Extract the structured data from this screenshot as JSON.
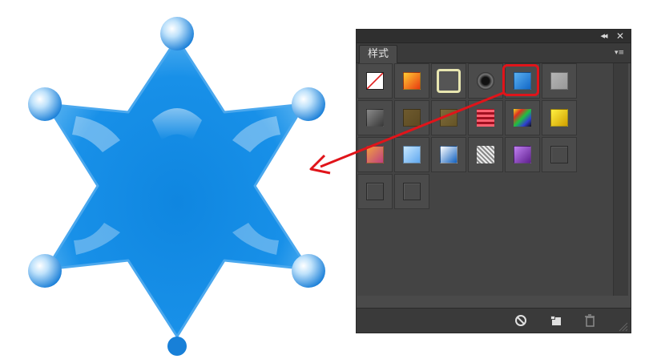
{
  "panel": {
    "tab_label": "样式",
    "collapse_glyph": "◂◂",
    "close_glyph": "✕",
    "menu_glyph": "▾≡"
  },
  "styles": [
    {
      "row": 0,
      "col": 0,
      "name": "style-none",
      "colors": [
        "#ffffff",
        "#e02020"
      ]
    },
    {
      "row": 0,
      "col": 1,
      "name": "style-red-glow",
      "colors": [
        "#ffcc33",
        "#e83a10"
      ]
    },
    {
      "row": 0,
      "col": 2,
      "name": "style-outline-frame",
      "colors": [
        "#555555",
        "#e8e6b0"
      ]
    },
    {
      "row": 0,
      "col": 3,
      "name": "style-black-ring",
      "colors": [
        "#111111",
        "#777777"
      ]
    },
    {
      "row": 0,
      "col": 4,
      "name": "style-blue-glass",
      "colors": [
        "#5ab0f0",
        "#1268c8"
      ],
      "selected": true
    },
    {
      "row": 0,
      "col": 5,
      "name": "style-gray-flat",
      "colors": [
        "#b4b4b4",
        "#999999"
      ]
    },
    {
      "row": 1,
      "col": 0,
      "name": "style-steel",
      "colors": [
        "#8a8a8a",
        "#3a3a3a"
      ]
    },
    {
      "row": 1,
      "col": 1,
      "name": "style-brown-inset",
      "colors": [
        "#6e5a2e",
        "#5c4a22"
      ]
    },
    {
      "row": 1,
      "col": 2,
      "name": "style-bronze",
      "colors": [
        "#7d6a3a",
        "#655426"
      ]
    },
    {
      "row": 1,
      "col": 3,
      "name": "style-red-stripes",
      "colors": [
        "#ff6070",
        "#a01020"
      ]
    },
    {
      "row": 1,
      "col": 4,
      "name": "style-rainbow",
      "colors": [
        "#f0e020",
        "#3040d0"
      ]
    },
    {
      "row": 1,
      "col": 5,
      "name": "style-gold",
      "colors": [
        "#fff040",
        "#d0a000"
      ]
    },
    {
      "row": 2,
      "col": 0,
      "name": "style-sunset",
      "colors": [
        "#f0a040",
        "#c04080"
      ]
    },
    {
      "row": 2,
      "col": 1,
      "name": "style-sky",
      "colors": [
        "#c8e8ff",
        "#60a8f0"
      ]
    },
    {
      "row": 2,
      "col": 2,
      "name": "style-ocean",
      "colors": [
        "#ffffff",
        "#1060c0"
      ]
    },
    {
      "row": 2,
      "col": 3,
      "name": "style-sparkle",
      "colors": [
        "#eeeeee",
        "#888888"
      ]
    },
    {
      "row": 2,
      "col": 4,
      "name": "style-purple",
      "colors": [
        "#c080f0",
        "#602090"
      ]
    },
    {
      "row": 2,
      "col": 5,
      "name": "style-dark-bevel",
      "colors": [
        "#4a4a4a",
        "#3c3c3c"
      ]
    },
    {
      "row": 3,
      "col": 0,
      "name": "style-empty-box-1",
      "colors": [
        "#4a4a4a",
        "#4a4a4a"
      ]
    },
    {
      "row": 3,
      "col": 1,
      "name": "style-empty-box-2",
      "colors": [
        "#4a4a4a",
        "#4a4a4a"
      ]
    }
  ],
  "colors": {
    "panel_bg": "#4a4a4a",
    "highlight": "#e0141a",
    "star_light": "#7cc8f8",
    "star_dark": "#0a78d8"
  },
  "bottom_icons": [
    "clear-style-icon",
    "new-style-icon",
    "trash-icon"
  ]
}
